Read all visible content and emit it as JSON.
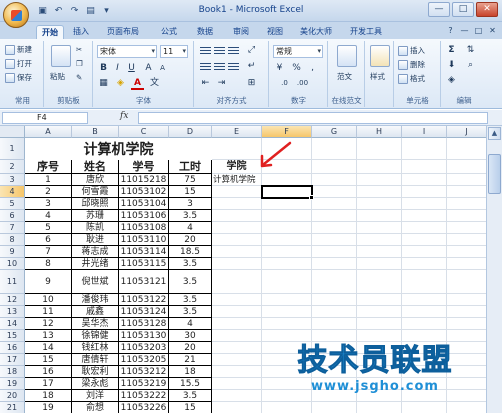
{
  "window": {
    "title": "Book1 - Microsoft Excel",
    "qat_icons": [
      "save-icon",
      "undo-icon",
      "redo-icon",
      "print-preview-icon",
      "customize-icon"
    ],
    "controls": [
      "—",
      "□",
      "✕"
    ]
  },
  "ribbon": {
    "tabs": [
      "开始",
      "插入",
      "页面布局",
      "公式",
      "数据",
      "审阅",
      "视图",
      "美化大师",
      "开发工具"
    ],
    "active_tab": "开始",
    "clipboard": {
      "new": "新建",
      "open": "打开",
      "save": "保存",
      "paste": "粘贴",
      "label_common": "常用",
      "label": "剪贴板"
    },
    "font": {
      "name": "宋体",
      "size": "11",
      "bold": "B",
      "italic": "I",
      "underline": "U",
      "font_color": "A",
      "label": "字体"
    },
    "alignment": {
      "label": "对齐方式"
    },
    "number": {
      "format": "常规",
      "percent": "%",
      "comma": ",",
      "label": "数字"
    },
    "styles": {
      "format_as_table": "范文",
      "cell_styles": "样式",
      "label_online": "在线范文"
    },
    "cells": {
      "insert": "插入",
      "delete": "删除",
      "format": "格式",
      "label": "单元格"
    },
    "editing": {
      "sum": "Σ",
      "label": "编辑"
    }
  },
  "formula_bar": {
    "name_box": "F4",
    "fx": "fx",
    "content": ""
  },
  "sheet": {
    "columns": [
      "A",
      "B",
      "C",
      "D",
      "E",
      "F",
      "G",
      "H",
      "I",
      "J"
    ],
    "selected_column": "F",
    "selected_row": "4",
    "rows": [
      "1",
      "2",
      "3",
      "4",
      "5",
      "6",
      "7",
      "8",
      "9",
      "10",
      "11",
      "12",
      "13",
      "14",
      "15",
      "16",
      "17",
      "18",
      "19",
      "20",
      "21"
    ],
    "title": "计算机学院",
    "headers": [
      "序号",
      "姓名",
      "学号",
      "工时"
    ],
    "e2": "学院",
    "e3": "计算机学院",
    "data": [
      [
        "1",
        "唐欣",
        "11015218",
        "75"
      ],
      [
        "2",
        "何雪霞",
        "11053102",
        "15"
      ],
      [
        "3",
        "邱晓照",
        "11053104",
        "3"
      ],
      [
        "4",
        "苏珊",
        "11053106",
        "3.5"
      ],
      [
        "5",
        "陈凯",
        "11053108",
        "4"
      ],
      [
        "6",
        "耿进",
        "11053110",
        "20"
      ],
      [
        "7",
        "蒋志成",
        "11053114",
        "18.5"
      ],
      [
        "8",
        "井光绪",
        "11053115",
        "3.5"
      ],
      [
        "9",
        "倪世斌",
        "11053121",
        "3.5"
      ],
      [
        "10",
        "潘俊玮",
        "11053122",
        "3.5"
      ],
      [
        "11",
        "戚鑫",
        "11053124",
        "3.5"
      ],
      [
        "12",
        "吴华杰",
        "11053128",
        "4"
      ],
      [
        "13",
        "徐锦健",
        "11053130",
        "30"
      ],
      [
        "14",
        "钱红林",
        "11053203",
        "20"
      ],
      [
        "15",
        "唐倩轩",
        "11053205",
        "21"
      ],
      [
        "16",
        "耿宏利",
        "11053212",
        "18"
      ],
      [
        "17",
        "梁永彪",
        "11053219",
        "15.5"
      ],
      [
        "18",
        "刘洋",
        "11053222",
        "3.5"
      ],
      [
        "19",
        "俞想",
        "11053226",
        "15"
      ]
    ]
  },
  "watermark": {
    "main": "技术员联盟",
    "sub": "www.jsgho.com"
  },
  "colors": {
    "accent": "#15428b",
    "arrow": "#e02020",
    "watermark": "#1f8fd6"
  }
}
